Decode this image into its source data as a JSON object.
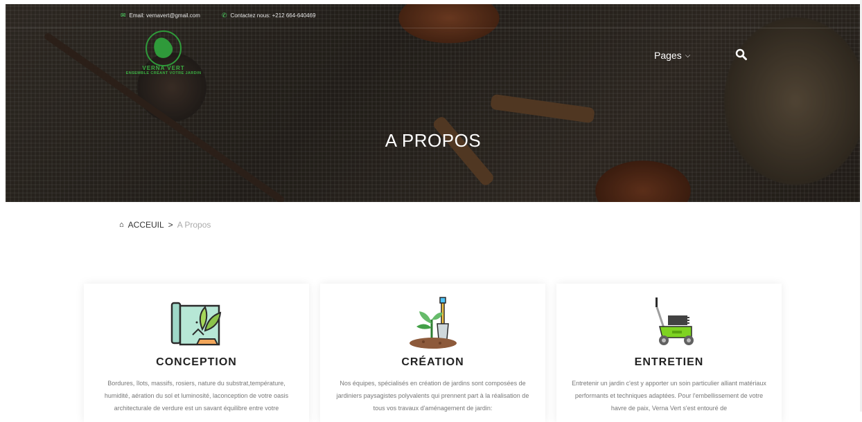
{
  "topbar": {
    "email": "Email: vernavert@gmail.com",
    "phone": "Contactez nous: +212 664-640469"
  },
  "logo": {
    "name": "VERNA VERT",
    "tagline": "ENSEMBLE CRÉANT VOTRE JARDIN"
  },
  "nav": {
    "pages_label": "Pages"
  },
  "hero": {
    "title": "A PROPOS"
  },
  "breadcrumb": {
    "home": "ACCEUIL",
    "separator": ">",
    "current": "A Propos"
  },
  "cards": [
    {
      "title": "CONCEPTION",
      "text": "Bordures, îlots, massifs, rosiers, nature du substrat,température, humidité, aération du sol et luminosité, laconception de votre oasis architecturale de verdure est un savant équilibre entre votre"
    },
    {
      "title": "CRÉATION",
      "text": "Nos équipes, spécialisés en création de jardins sont composées de jardiniers paysagistes polyvalents qui prennent part à la réalisation de tous vos travaux d'aménagement de jardin:"
    },
    {
      "title": "ENTRETIEN",
      "text": "Entretenir un jardin c'est y apporter un soin particulier alliant matériaux performants et techniques adaptées. Pour l'embellissement de votre havre de paix, Verna Vert s'est entouré de"
    }
  ],
  "colors": {
    "accent_green": "#4cd964",
    "brand_green": "#3cb043"
  }
}
